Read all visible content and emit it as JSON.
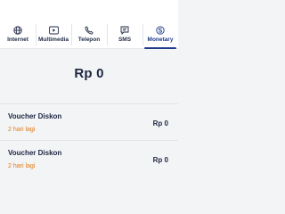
{
  "tabs": [
    {
      "label": "Internet",
      "icon": "globe-icon",
      "active": false
    },
    {
      "label": "Multimedia",
      "icon": "play-icon",
      "active": false
    },
    {
      "label": "Telepon",
      "icon": "phone-icon",
      "active": false
    },
    {
      "label": "SMS",
      "icon": "message-icon",
      "active": false
    },
    {
      "label": "Monetary",
      "icon": "coin-icon",
      "active": true
    }
  ],
  "balance": "Rp 0",
  "vouchers": [
    {
      "title": "Voucher Diskon",
      "expiry": "2 hari lagi",
      "price": "Rp 0"
    },
    {
      "title": "Voucher Diskon",
      "expiry": "2 hari lagi",
      "price": "Rp 0"
    }
  ],
  "colors": {
    "text": "#1c2640",
    "active_tab": "#1e3a8a",
    "expiry": "#e07b17",
    "background": "#f3f4f6"
  }
}
